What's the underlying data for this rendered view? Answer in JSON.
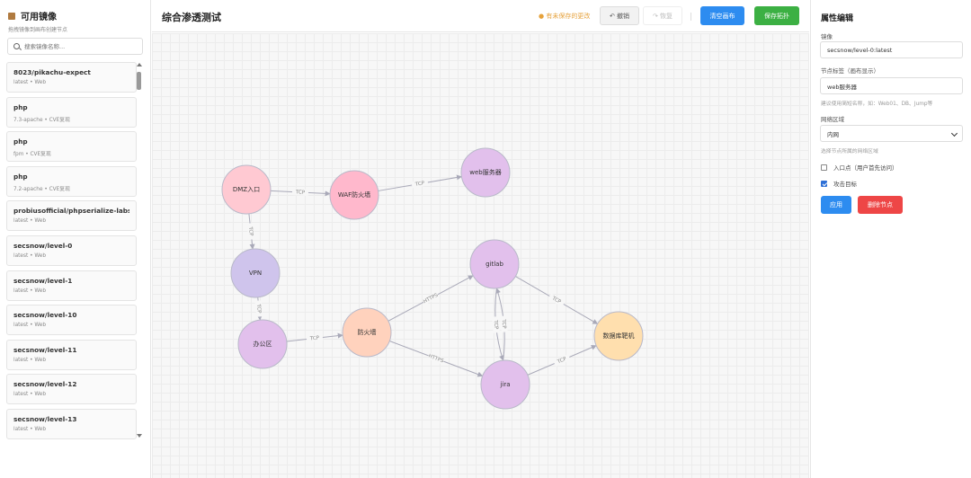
{
  "sidebar": {
    "title": "可用镜像",
    "hint": "拖拽镜像到画布创建节点",
    "search_placeholder": "搜索镜像名称...",
    "images": [
      {
        "name": "8023/pikachu-expect",
        "meta": "latest • Web"
      },
      {
        "name": "php",
        "meta": "7.3-apache • CVE复现"
      },
      {
        "name": "php",
        "meta": "fpm • CVE复现"
      },
      {
        "name": "php",
        "meta": "7.2-apache • CVE复现"
      },
      {
        "name": "probiusofficial/phpserialize-labs",
        "meta": "latest • Web"
      },
      {
        "name": "secsnow/level-0",
        "meta": "latest • Web"
      },
      {
        "name": "secsnow/level-1",
        "meta": "latest • Web"
      },
      {
        "name": "secsnow/level-10",
        "meta": "latest • Web"
      },
      {
        "name": "secsnow/level-11",
        "meta": "latest • Web"
      },
      {
        "name": "secsnow/level-12",
        "meta": "latest • Web"
      },
      {
        "name": "secsnow/level-13",
        "meta": "latest • Web"
      }
    ]
  },
  "toolbar": {
    "title": "综合渗透测试",
    "unsaved": "● 有未保存的更改",
    "undo": "↶ 撤销",
    "redo": "↷ 恢复",
    "clear": "清空画布",
    "save": "保存拓扑"
  },
  "topology": {
    "nodes": [
      {
        "id": "dmz",
        "label": "DMZ入口",
        "color": "#ffc9d2"
      },
      {
        "id": "waf",
        "label": "WAF防火墙",
        "color": "#ffb8cc"
      },
      {
        "id": "web",
        "label": "web服务器",
        "color": "#e2c0ec"
      },
      {
        "id": "vpn",
        "label": "VPN",
        "color": "#cfc4ec"
      },
      {
        "id": "office",
        "label": "办公区",
        "color": "#e2c0ec"
      },
      {
        "id": "firewall",
        "label": "防火墙",
        "color": "#ffd2bd"
      },
      {
        "id": "gitlab",
        "label": "gitlab",
        "color": "#e2c0ec"
      },
      {
        "id": "jira",
        "label": "jira",
        "color": "#e2c0ec"
      },
      {
        "id": "db",
        "label": "数据库靶机",
        "color": "#ffdfae"
      }
    ],
    "edges": [
      {
        "from": "dmz",
        "to": "waf",
        "label": "TCP"
      },
      {
        "from": "waf",
        "to": "web",
        "label": "TCP"
      },
      {
        "from": "dmz",
        "to": "vpn",
        "label": "TCP"
      },
      {
        "from": "vpn",
        "to": "office",
        "label": "TCP"
      },
      {
        "from": "office",
        "to": "firewall",
        "label": "TCP"
      },
      {
        "from": "firewall",
        "to": "gitlab",
        "label": "HTTPS"
      },
      {
        "from": "firewall",
        "to": "jira",
        "label": "HTTPS"
      },
      {
        "from": "gitlab",
        "to": "db",
        "label": "TCP"
      },
      {
        "from": "jira",
        "to": "db",
        "label": "TCP"
      },
      {
        "from": "gitlab",
        "to": "jira",
        "label": "TCP",
        "curve": 1
      },
      {
        "from": "jira",
        "to": "gitlab",
        "label": "TCP",
        "curve": 1
      }
    ],
    "edge_color": "#a9a9b8"
  },
  "properties": {
    "title": "属性编辑",
    "image_label": "镜像",
    "image_value": "secsnow/level-0:latest",
    "node_label_label": "节点标签（画布显示）",
    "node_label_value": "web服务器",
    "node_label_hint": "建议使用简短名称，如：Web01、DB、Jump等",
    "zone_label": "网络区域",
    "zone_value": "内网",
    "zone_hint": "选择节点所属的网络区域",
    "entry_label": "入口点（用户首先访问）",
    "entry_checked": false,
    "target_label": "攻击目标",
    "target_checked": true,
    "apply": "应用",
    "delete": "删除节点"
  }
}
